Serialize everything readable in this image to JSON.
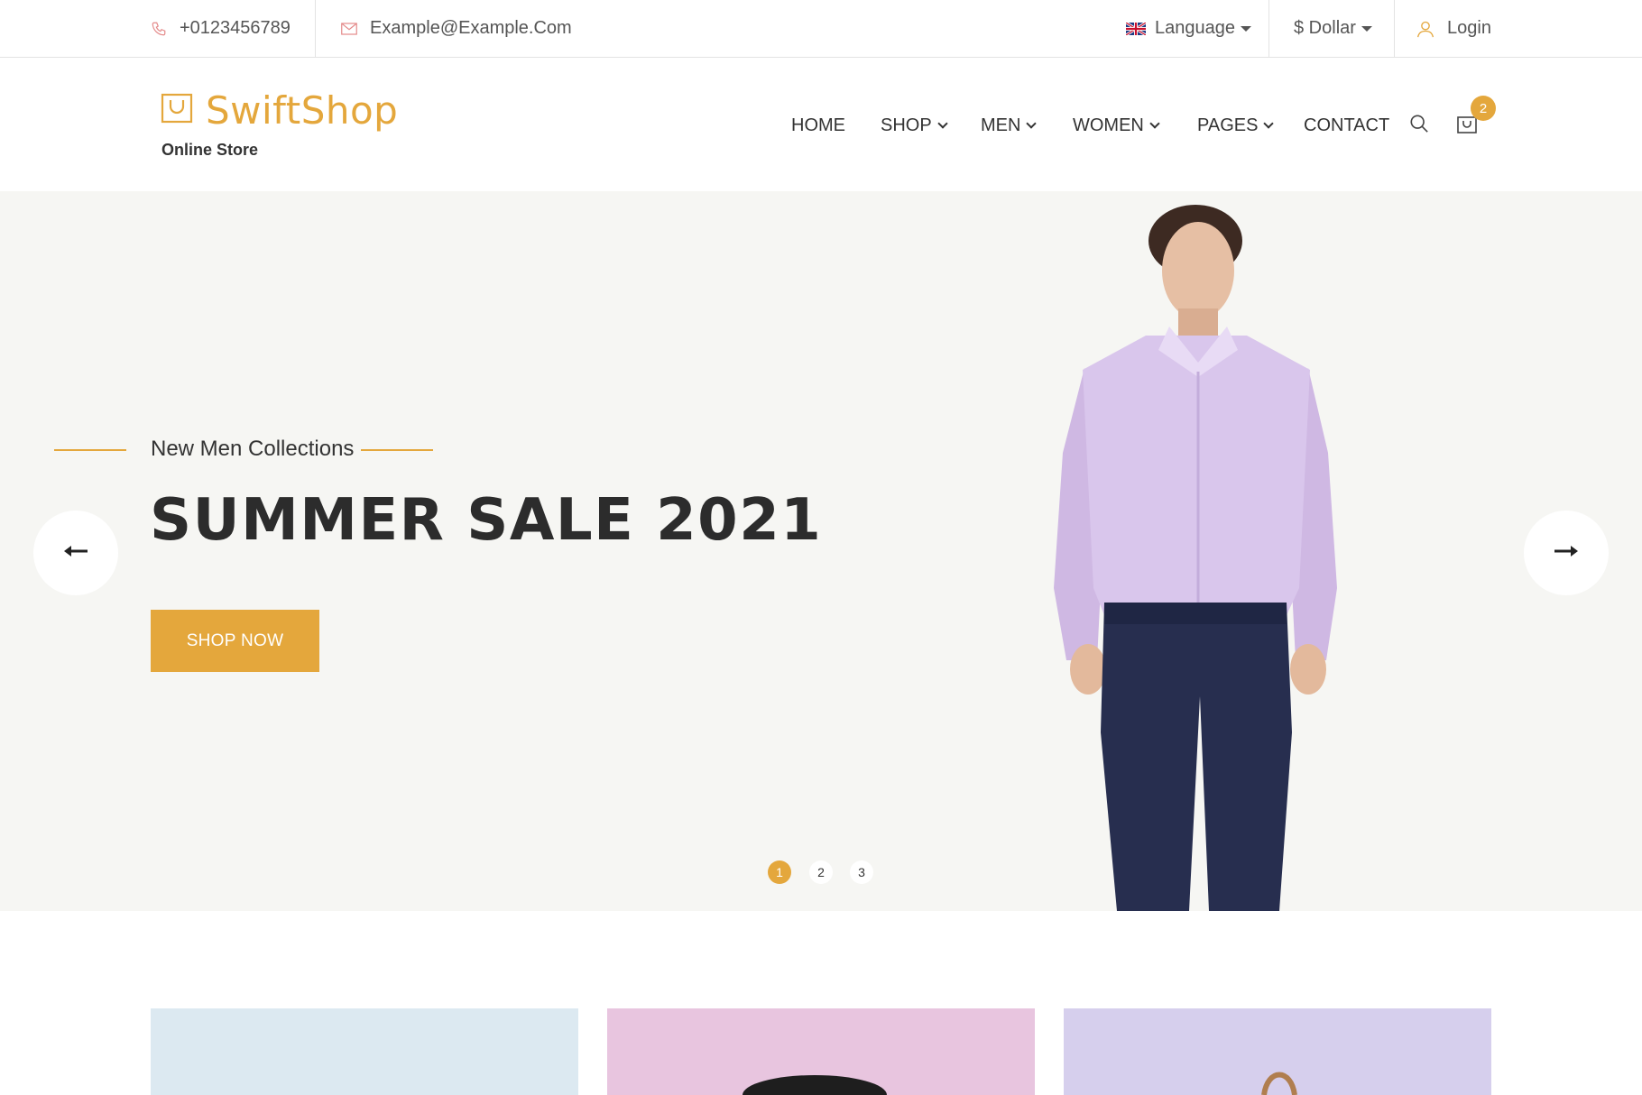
{
  "topbar": {
    "phone": "+0123456789",
    "email": "Example@Example.Com",
    "language": "Language",
    "currency": "$ Dollar",
    "login": "Login"
  },
  "header": {
    "logo_text": "SwiftShop",
    "logo_subtitle": "Online Store",
    "nav": [
      {
        "label": "HOME",
        "dropdown": false
      },
      {
        "label": "SHOP",
        "dropdown": true
      },
      {
        "label": "MEN",
        "dropdown": true
      },
      {
        "label": "WOMEN",
        "dropdown": true
      },
      {
        "label": "PAGES",
        "dropdown": true
      },
      {
        "label": "CONTACT",
        "dropdown": false
      }
    ],
    "cart_count": "2"
  },
  "hero": {
    "subtitle": "New Men Collections",
    "title": "SUMMER SALE 2021",
    "button": "SHOP NOW",
    "dots": [
      "1",
      "2",
      "3"
    ],
    "active_dot": 1
  },
  "categories": {
    "card_colors": [
      "#dce9f1",
      "#e8c5df",
      "#d6cfed"
    ]
  },
  "colors": {
    "accent": "#e4a73c",
    "hero_bg": "#f6f6f3",
    "text_dark": "#2c2c2c"
  },
  "icons": [
    "phone-icon",
    "mail-icon",
    "flag-uk-icon",
    "user-icon",
    "bag-logo-icon",
    "search-icon",
    "cart-icon",
    "arrow-left-icon",
    "arrow-right-icon"
  ]
}
